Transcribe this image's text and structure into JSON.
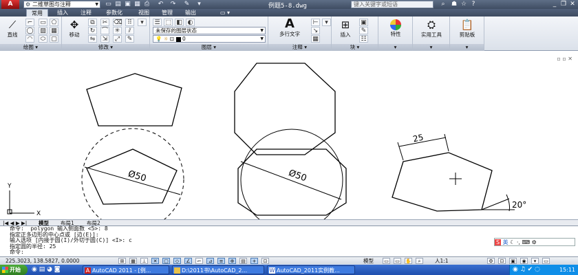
{
  "app": {
    "logo": "A",
    "workspace": "二维草图与注释",
    "document_title": "例题5-8.dwg",
    "help_search_placeholder": "键入关键字或短语"
  },
  "ribbon_tabs": [
    "常用",
    "插入",
    "注释",
    "参数化",
    "视图",
    "管理",
    "输出"
  ],
  "ribbon": {
    "draw": {
      "line_label": "直线",
      "panel_label": "绘图"
    },
    "modify": {
      "move_label": "移动",
      "panel_label": "修改"
    },
    "layers": {
      "state_value": "未保存的图层状态",
      "layer_value": "0",
      "panel_label": "图层"
    },
    "annotation": {
      "mtext_label": "多行文字",
      "panel_label": "注释"
    },
    "block": {
      "insert_label": "插入",
      "panel_label": "块"
    },
    "properties_label": "特性",
    "utilities_label": "实用工具",
    "clipboard_label": "剪贴板"
  },
  "drawing": {
    "dim_circle_1": "Ø50",
    "dim_circle_2": "Ø50",
    "dim_side": "25",
    "dim_angle": "20°",
    "ucs_x": "X",
    "ucs_y": "Y"
  },
  "layout_tabs": [
    "模型",
    "布局1",
    "布局2"
  ],
  "command_lines": [
    "命令:  polygon 输入侧面数 <5>: 8",
    "指定正多边形的中心点或 [边(E)]:",
    "输入选项 [内接于圆(I)/外切于圆(C)] <I>: c",
    "指定圆的半径: 25",
    "命令:"
  ],
  "ime": {
    "label": "英"
  },
  "status": {
    "coordinates": "225.3023, 138.5827, 0.0000",
    "model_label": "模型",
    "scale": "人1:1"
  },
  "taskbar": {
    "start": "开始",
    "tasks": [
      "AutoCAD 2011 - [例...",
      "D:\\2011书\\AutoCAD_2...",
      "AutoCAD_2011实例教..."
    ],
    "clock": "15:11"
  },
  "colors": {
    "titlebar": "#4a5870",
    "taskbar": "#2a5cc0",
    "start": "#3a952c"
  }
}
